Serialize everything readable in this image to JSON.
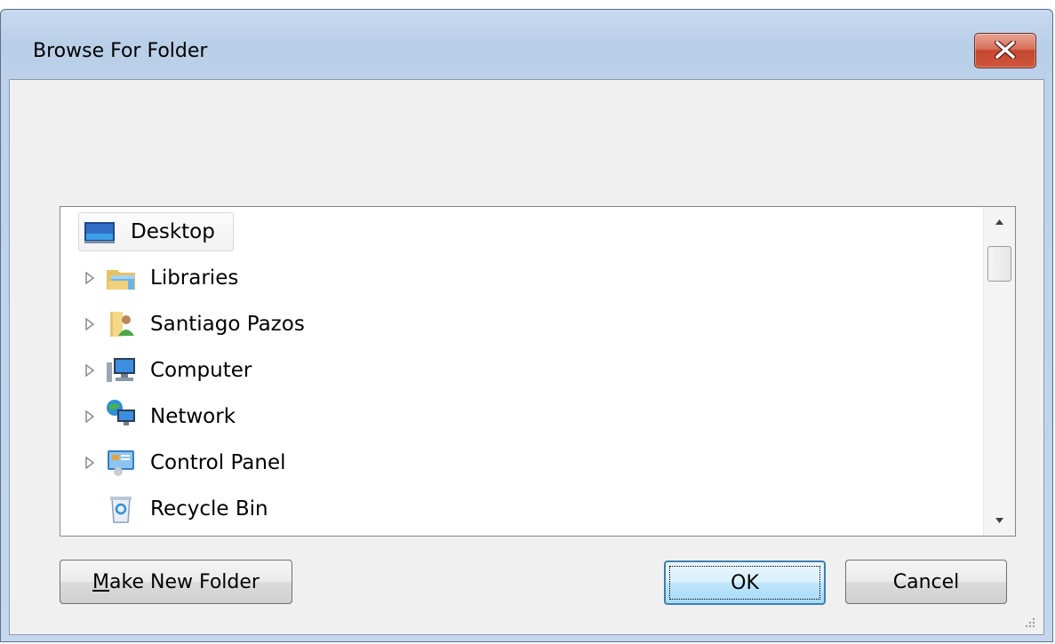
{
  "window": {
    "title": "Browse For Folder"
  },
  "tree": {
    "items": [
      {
        "label": "Desktop",
        "icon": "desktop-icon",
        "expandable": false,
        "selected": true
      },
      {
        "label": "Libraries",
        "icon": "libraries-icon",
        "expandable": true
      },
      {
        "label": "Santiago Pazos",
        "icon": "user-folder-icon",
        "expandable": true
      },
      {
        "label": "Computer",
        "icon": "computer-icon",
        "expandable": true
      },
      {
        "label": "Network",
        "icon": "network-icon",
        "expandable": true
      },
      {
        "label": "Control Panel",
        "icon": "control-panel-icon",
        "expandable": true
      },
      {
        "label": "Recycle Bin",
        "icon": "recycle-bin-icon",
        "expandable": false
      }
    ]
  },
  "buttons": {
    "make_new_folder_mnemonic": "M",
    "make_new_folder_rest": "ake New Folder",
    "ok": "OK",
    "cancel": "Cancel"
  },
  "colors": {
    "title_bar": "#bcd1ea",
    "close_button": "#c5462f",
    "ok_border": "#3c7fb1"
  }
}
